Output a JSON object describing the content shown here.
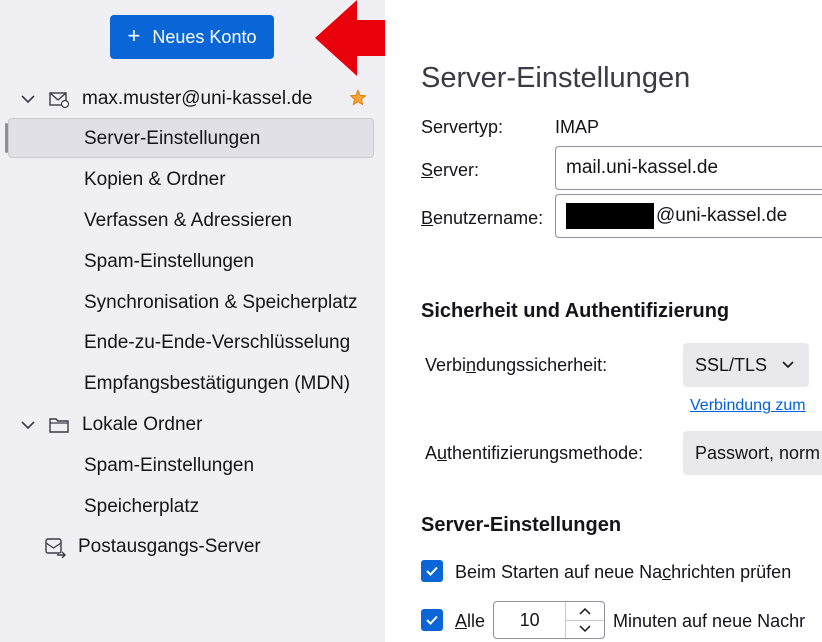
{
  "toolbar": {
    "new_account_label": "Neues Konto"
  },
  "sidebar": {
    "account": "max.muster@uni-kassel.de",
    "account_items": [
      "Server-Einstellungen",
      "Kopien & Ordner",
      "Verfassen & Adressieren",
      "Spam-Einstellungen",
      "Synchronisation & Speicherplatz",
      "Ende-zu-Ende-Verschlüsselung",
      "Empfangsbestätigungen (MDN)"
    ],
    "local_folders": "Lokale Ordner",
    "local_items": [
      "Spam-Einstellungen",
      "Speicherplatz"
    ],
    "outgoing_server": "Postausgangs-Server"
  },
  "main": {
    "title": "Server-Einstellungen",
    "servertype_label": "Servertyp:",
    "servertype_value": "IMAP",
    "server_label_pre": "",
    "server_label_key": "S",
    "server_label_post": "erver:",
    "server_value": "mail.uni-kassel.de",
    "username_label_key": "B",
    "username_label_post": "enutzername:",
    "username_suffix": "@uni-kassel.de",
    "security_heading": "Sicherheit und Authentifizierung",
    "connection_label_pre": "Verbi",
    "connection_label_key": "n",
    "connection_label_post": "dungssicherheit:",
    "connection_value": "SSL/TLS",
    "connection_link": "Verbindung zum",
    "auth_label_pre": "A",
    "auth_label_key": "u",
    "auth_label_post": "thentifizierungsmethode:",
    "auth_value": "Passwort, norm",
    "server_settings_heading": "Server-Einstellungen",
    "check_on_start_pre": "Beim Starten auf neue Na",
    "check_on_start_key": "c",
    "check_on_start_post": "hrichten prüfen",
    "check_every_label_key": "A",
    "check_every_label_post": "lle",
    "check_every_value": "10",
    "check_every_suffix": "Minuten auf neue Nachr"
  },
  "colors": {
    "accent": "#0a66d6",
    "arrow": "#e8000b",
    "sidebar_bg": "#f0f0f4",
    "link": "#0061e0"
  }
}
